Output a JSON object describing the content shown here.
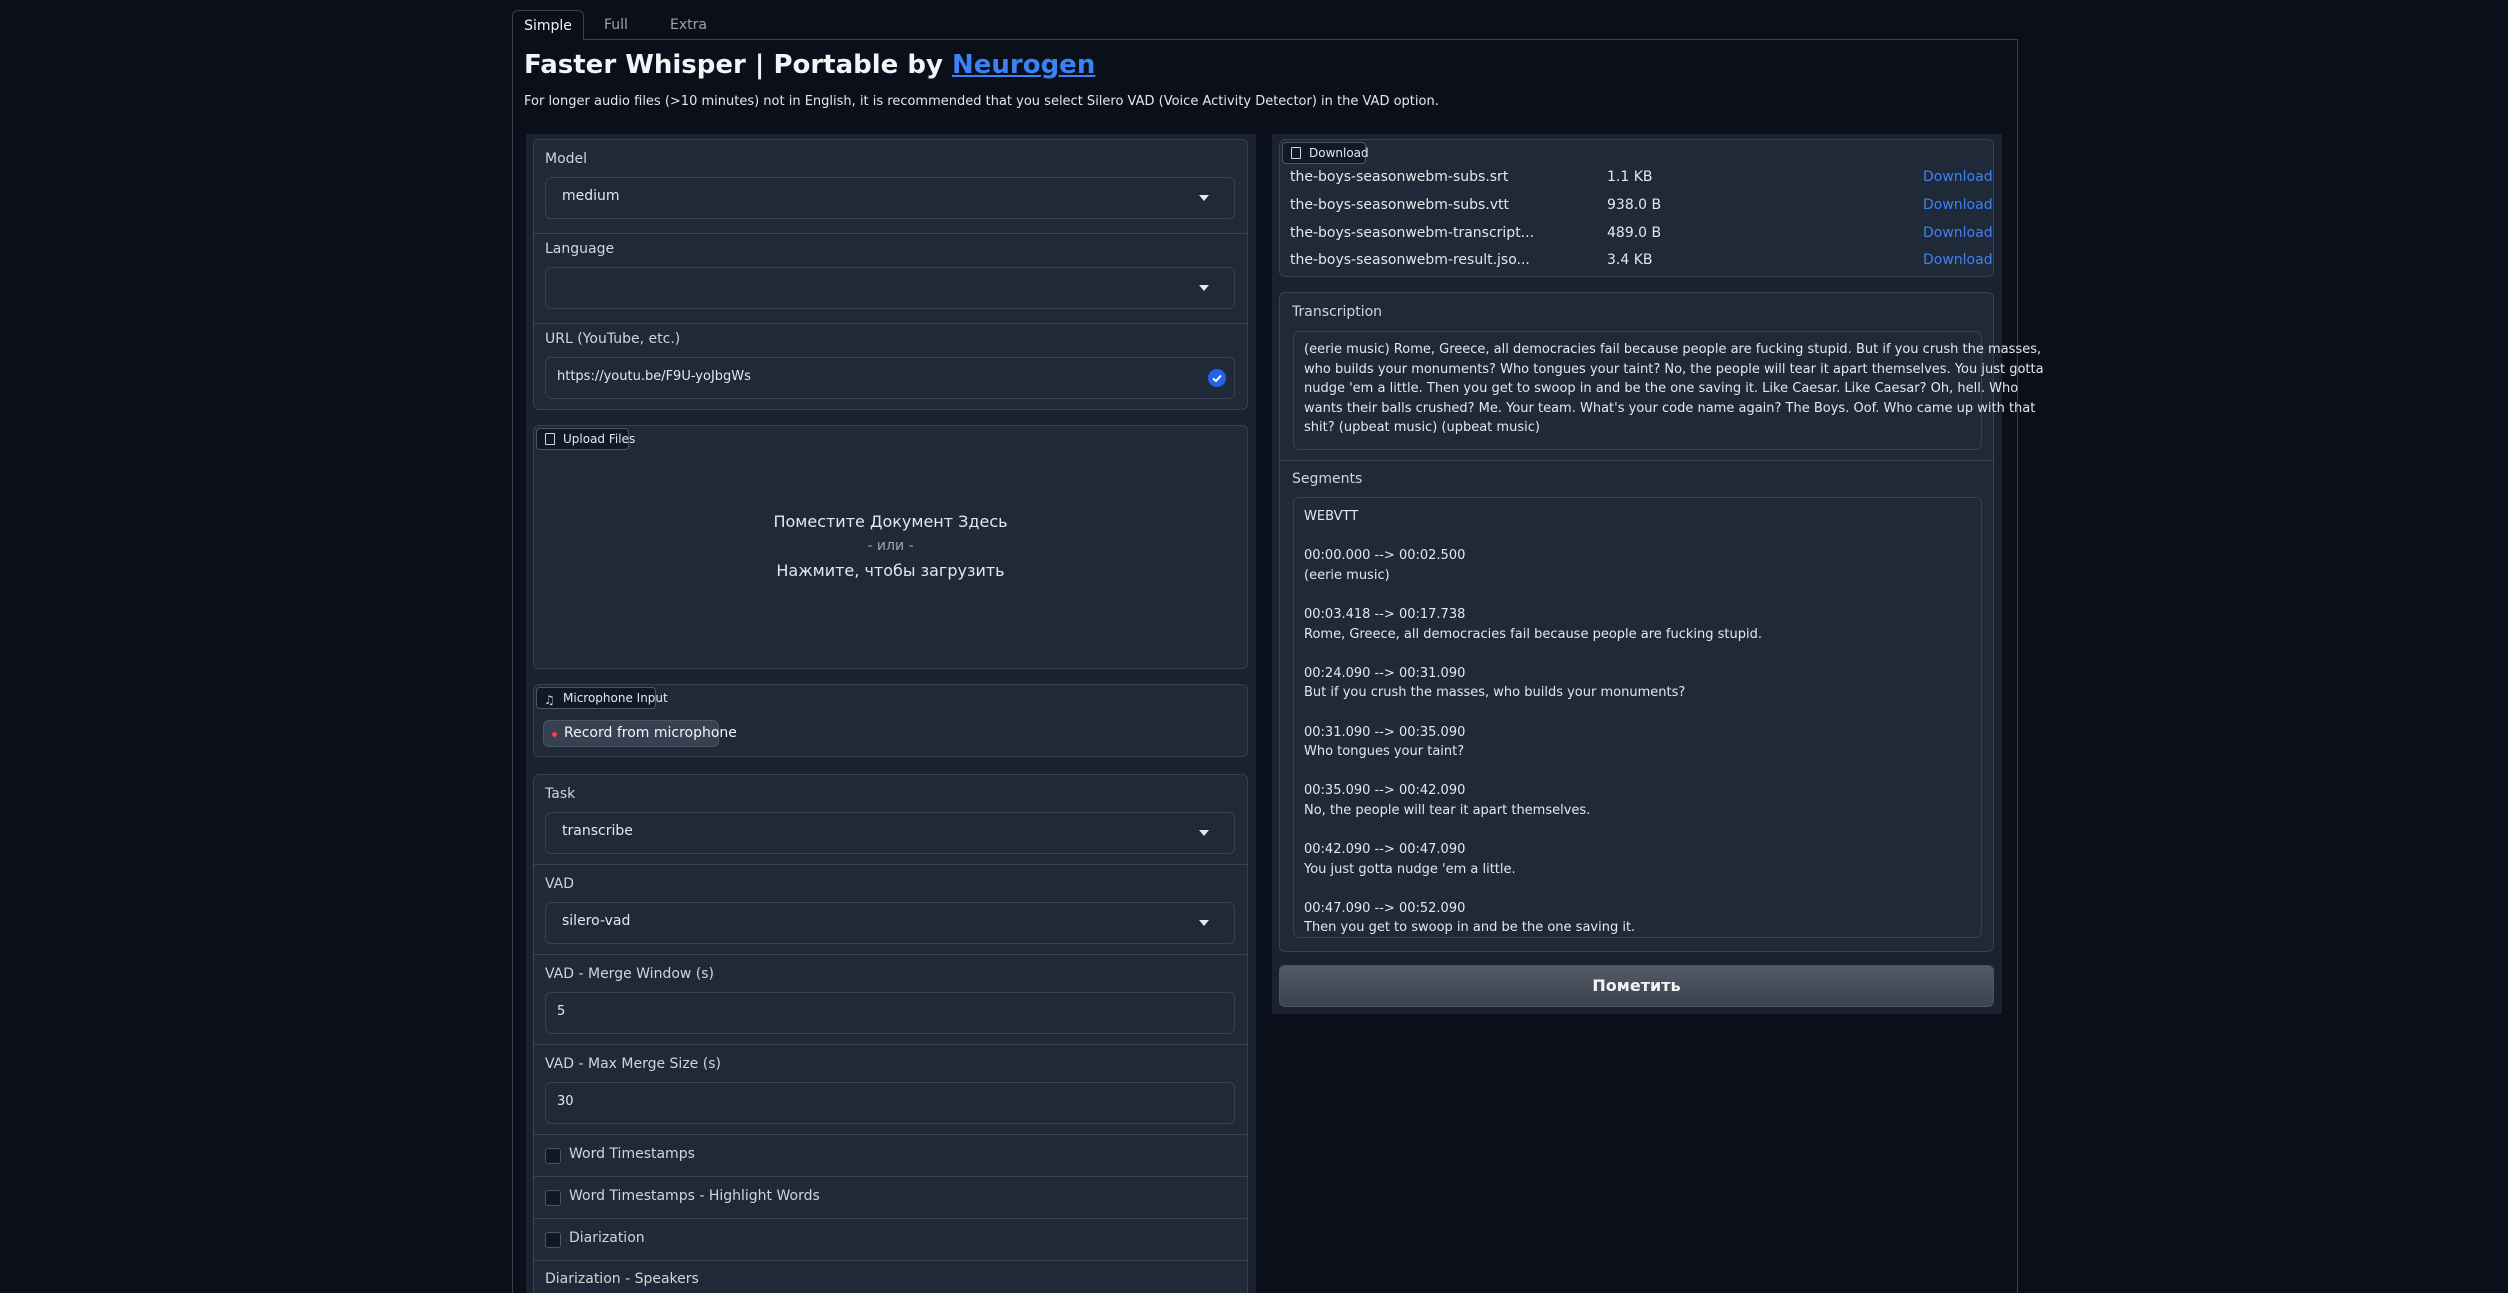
{
  "tabs": [
    "Simple",
    "Full",
    "Extra"
  ],
  "header": {
    "title_prefix": "Faster Whisper | Portable by ",
    "title_link": "Neurogen",
    "subtitle": "For longer audio files (>10 minutes) not in English, it is recommended that you select Silero VAD (Voice Activity Detector) in the VAD option."
  },
  "model": {
    "label": "Model",
    "value": "medium"
  },
  "language": {
    "label": "Language",
    "value": ""
  },
  "url": {
    "label": "URL (YouTube, etc.)",
    "value": "https://youtu.be/F9U-yoJbgWs"
  },
  "upload": {
    "badge": "Upload Files",
    "line1": "Поместите Документ Здесь",
    "line2": "- или -",
    "line3": "Нажмите, чтобы загрузить"
  },
  "microphone": {
    "badge": "Microphone Input",
    "button": "Record from microphone"
  },
  "task": {
    "label": "Task",
    "value": "transcribe"
  },
  "vad": {
    "label": "VAD",
    "value": "silero-vad"
  },
  "merge_window": {
    "label": "VAD - Merge Window (s)",
    "value": "5"
  },
  "max_merge": {
    "label": "VAD - Max Merge Size (s)",
    "value": "30"
  },
  "checkboxes": {
    "word_timestamps": "Word Timestamps",
    "highlight_words": "Word Timestamps - Highlight Words",
    "diarization": "Diarization"
  },
  "diarization_speakers": {
    "label": "Diarization - Speakers"
  },
  "download": {
    "badge": "Download",
    "link_label": "Download",
    "files": [
      {
        "name": "the-boys-seasonwebm-subs.srt",
        "size": "1.1 KB"
      },
      {
        "name": "the-boys-seasonwebm-subs.vtt",
        "size": "938.0 B"
      },
      {
        "name": "the-boys-seasonwebm-transcript...",
        "size": "489.0 B"
      },
      {
        "name": "the-boys-seasonwebm-result.jso...",
        "size": "3.4 KB"
      }
    ]
  },
  "transcription": {
    "label": "Transcription",
    "lines": [
      " (eerie music) Rome, Greece, all democracies fail because people are fucking stupid. But if you crush the masses,",
      "who builds your monuments?  Who tongues your taint?  No, the people will tear it apart themselves.  You just gotta",
      "nudge 'em a little.  Then you get to swoop in and be the one saving it. Like Caesar.  Like Caesar? Oh, hell.  Who",
      "wants their balls crushed? Me.  Your team. What's your code name again?  The Boys.  Oof. Who came up with that",
      "shit? (upbeat music) (upbeat music)"
    ]
  },
  "segments": {
    "label": "Segments",
    "lines": [
      "WEBVTT",
      "",
      "00:00.000 --> 00:02.500",
      "(eerie music)",
      "",
      "00:03.418 --> 00:17.738",
      "Rome, Greece, all democracies fail because people are fucking stupid.",
      "",
      "00:24.090 --> 00:31.090",
      "But if you crush the masses, who builds your monuments?",
      "",
      "00:31.090 --> 00:35.090",
      "Who tongues your taint?",
      "",
      "00:35.090 --> 00:42.090",
      "No, the people will tear it apart themselves.",
      "",
      "00:42.090 --> 00:47.090",
      "You just gotta nudge 'em a little.",
      "",
      "00:47.090 --> 00:52.090",
      "Then you get to swoop in and be the one saving it."
    ]
  },
  "submit": {
    "label": "Пометить"
  }
}
